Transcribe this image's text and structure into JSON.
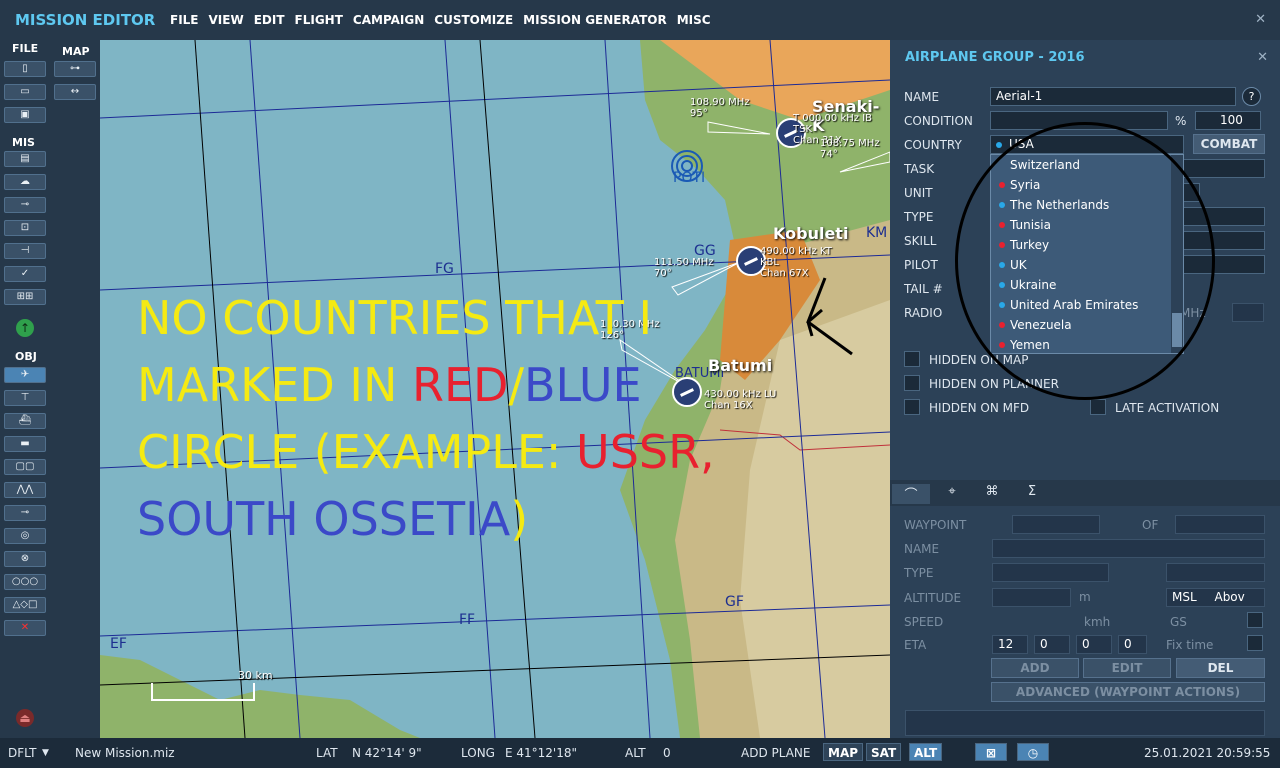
{
  "app": {
    "title": "MISSION EDITOR"
  },
  "menu": [
    "FILE",
    "VIEW",
    "EDIT",
    "FLIGHT",
    "CAMPAIGN",
    "CUSTOMIZE",
    "MISSION GENERATOR",
    "MISC"
  ],
  "toolbar": {
    "file_label": "FILE",
    "map_label": "MAP",
    "mis_label": "MIS",
    "obj_label": "OBJ"
  },
  "map": {
    "grid_labels": [
      "FG",
      "GG",
      "KM",
      "FF",
      "GF",
      "EF"
    ],
    "cities": [
      "Senaki-K",
      "Kobuleti",
      "Batumi"
    ],
    "other_labels": [
      "POTI",
      "BATUMI"
    ],
    "scale": "30 km",
    "frequencies": {
      "senaki": [
        "108.90 MHz",
        "95°"
      ],
      "senaki_tacan": [
        "T 000.00 kHz IB",
        "TSK",
        "Chan 31X"
      ],
      "senaki_right": [
        "108.75 MHz",
        "74°"
      ],
      "kobuleti": [
        "111.50 MHz",
        "70°"
      ],
      "kobuleti_tacan": [
        "490.00 kHz KT",
        "KBL",
        "Chan 67X"
      ],
      "batumi": [
        "110.30 MHz",
        "126°"
      ],
      "batumi_tacan": [
        "430.00 kHz LU",
        "Chan 16X"
      ]
    },
    "overlay": {
      "line1": "NO COUNTRIES THAT I",
      "line2a": "MARKED IN ",
      "line2_red": "RED",
      "line2_slash": "/",
      "line2_blue": "BLUE",
      "line3a": "CIRCLE (EXAMPLE: ",
      "line3_red": "USSR,",
      "line4_blue": "SOUTH OSSETIA",
      "line4_end": ")"
    }
  },
  "panel": {
    "title": "AIRPLANE GROUP - 2016",
    "name_label": "NAME",
    "name_value": "Aerial-1",
    "help": "?",
    "condition_label": "CONDITION",
    "condition_unit": "%",
    "condition_value": "100",
    "country_label": "COUNTRY",
    "country_value": "USA",
    "combat_button": "COMBAT",
    "task_label": "TASK",
    "unit_label": "UNIT",
    "type_label": "TYPE",
    "skill_label": "SKILL",
    "pilot_label": "PILOT",
    "tail_label": "TAIL #",
    "radio_label": "RADIO",
    "radio_unit": "MHz",
    "hidden_map": "HIDDEN ON MAP",
    "hidden_planner": "HIDDEN ON PLANNER",
    "hidden_mfd": "HIDDEN ON MFD",
    "late_activation": "LATE ACTIVATION"
  },
  "country_list": [
    {
      "name": "Switzerland",
      "side": "none"
    },
    {
      "name": "Syria",
      "side": "red"
    },
    {
      "name": "The Netherlands",
      "side": "blue"
    },
    {
      "name": "Tunisia",
      "side": "red"
    },
    {
      "name": "Turkey",
      "side": "red"
    },
    {
      "name": "UK",
      "side": "blue"
    },
    {
      "name": "Ukraine",
      "side": "blue"
    },
    {
      "name": "United Arab Emirates",
      "side": "blue"
    },
    {
      "name": "Venezuela",
      "side": "red"
    },
    {
      "name": "Yemen",
      "side": "red"
    }
  ],
  "colors": {
    "red": "#e8212f",
    "blue": "#29a8e8",
    "accent": "#5ec8f0"
  },
  "waypoint": {
    "waypoint_label": "WAYPOINT",
    "of_label": "OF",
    "name_label": "NAME",
    "type_label": "TYPE",
    "altitude_label": "ALTITUDE",
    "altitude_unit": "m",
    "msl": "MSL",
    "above": "Abov",
    "speed_label": "SPEED",
    "speed_unit": "kmh",
    "gs_label": "GS",
    "eta_label": "ETA",
    "eta_h": "12",
    "eta_m": "0",
    "eta_s": "0",
    "eta_d": "0",
    "fix_time": "Fix time",
    "add": "ADD",
    "edit": "EDIT",
    "del": "DEL",
    "advanced": "ADVANCED (WAYPOINT ACTIONS)"
  },
  "status": {
    "profile": "DFLT",
    "file": "New Mission.miz",
    "lat_label": "LAT",
    "lat": "N 42°14' 9\"",
    "long_label": "LONG",
    "long": "E 41°12'18\"",
    "alt_label": "ALT",
    "alt": "0",
    "mode": "ADD PLANE",
    "map_btn": "MAP",
    "sat_btn": "SAT",
    "alt_btn": "ALT",
    "datetime": "25.01.2021 20:59:55"
  }
}
